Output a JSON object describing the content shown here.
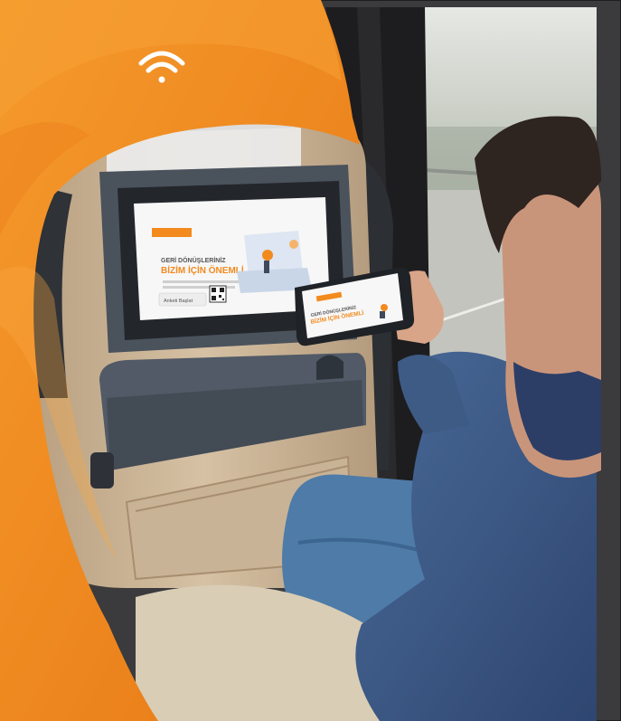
{
  "scene": {
    "colors": {
      "brand_orange": "#F28A1E",
      "brand_orange_dark": "#E06E10",
      "seat_tan": "#CDB79A",
      "panel_gray": "#4A525C",
      "sweater_blue": "#3E5B86",
      "jeans_blue": "#4E7BA8",
      "window_light": "#C9CDC7"
    },
    "icons": [
      "wifi-icon",
      "qr-code-icon"
    ]
  },
  "seatback_screen": {
    "logo": "",
    "heading_line1": "GERİ DÖNÜŞLERİNİZ",
    "heading_line2": "BİZİM İÇİN ÖNEMLİ",
    "button": "Anketi Başlat"
  },
  "phone_screen": {
    "heading_line1": "GERİ DÖNÜŞLERİNİZ",
    "heading_line2": "BİZİM İÇİN ÖNEMLİ"
  }
}
